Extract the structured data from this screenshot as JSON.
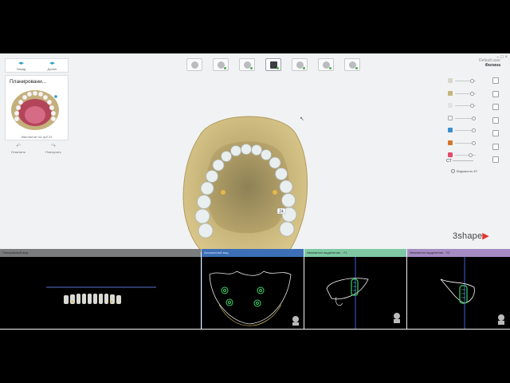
{
  "nav": {
    "back_label": "Назад",
    "next_label": "Далее"
  },
  "plan": {
    "title": "Планировани...",
    "implant_caption": "Имплантат на зуб 24",
    "undo_label": "Отменить",
    "redo_label": "Повторить"
  },
  "user": {
    "mode": "Default user",
    "name": "Филина"
  },
  "scene": {
    "tooth_number": "24",
    "logo_text": "3shape",
    "logo_mark": "▶"
  },
  "controls": {
    "ct_label": "CT",
    "ct_visibility_label": "Видимость КТ"
  },
  "toolbar": {
    "icons": [
      "patient-icon",
      "scan-icon",
      "crown-icon",
      "implant-icon",
      "ct-icon",
      "guide-icon",
      "export-icon"
    ]
  },
  "viewports": [
    {
      "title": "Панорамный вид",
      "color": "#7a7c7e"
    },
    {
      "title": "Аксиальный вид",
      "color": "#3c6fb5"
    },
    {
      "title": "Имплантат выделение - Y1",
      "color": "#7ec9a4"
    },
    {
      "title": "Имплантат выделение - Y2",
      "color": "#a68bc4"
    }
  ],
  "colors": {
    "bone": "#c7b479",
    "tooth": "#e7ecec",
    "accent": "#2e9fc9",
    "implant_green": "#3ecf6a"
  }
}
